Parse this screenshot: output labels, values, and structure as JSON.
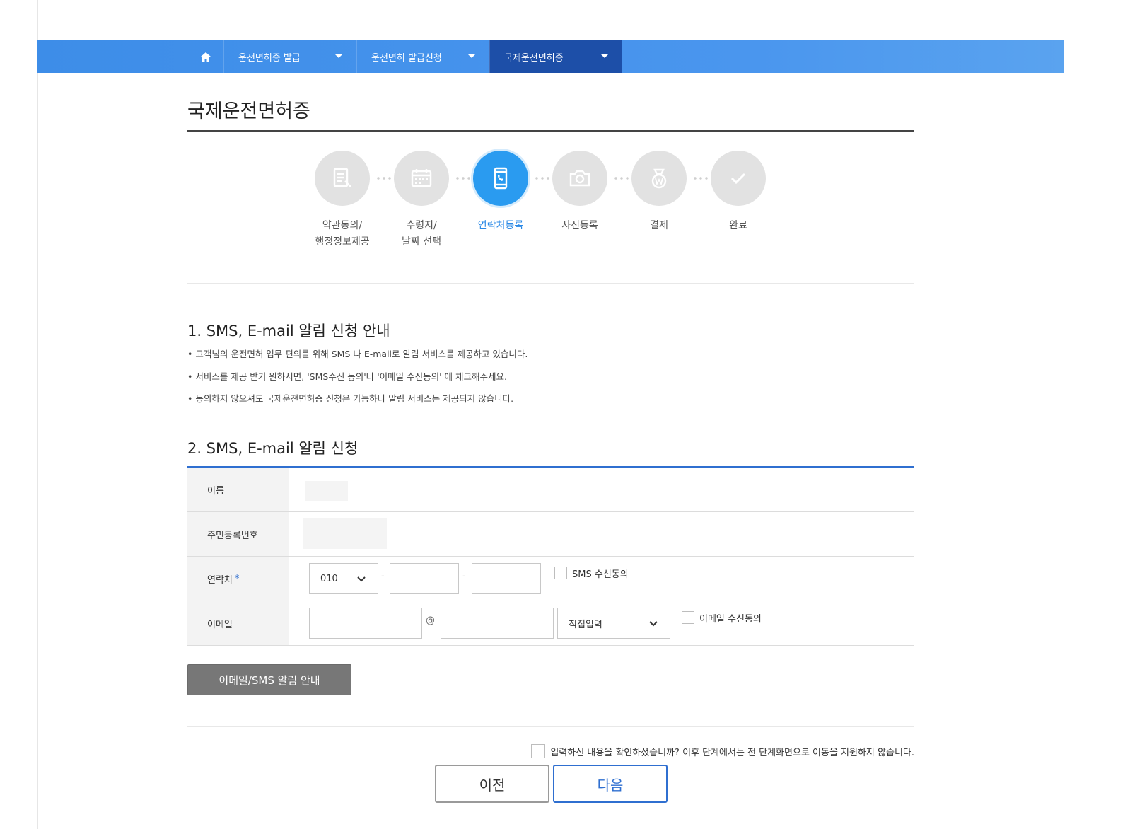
{
  "nav": {
    "items": [
      {
        "label": "운전면허증 발급"
      },
      {
        "label": "운전면허 발급신청"
      },
      {
        "label": "국제운전면허증"
      }
    ]
  },
  "page": {
    "title": "국제운전면허증"
  },
  "steps": [
    {
      "line1": "약관동의/",
      "line2": "행정정보제공",
      "icon": "document-icon"
    },
    {
      "line1": "수령지/",
      "line2": "날짜 선택",
      "icon": "calendar-icon"
    },
    {
      "line1": "연락처등록",
      "line2": "",
      "icon": "phone-icon",
      "active": true
    },
    {
      "line1": "사진등록",
      "line2": "",
      "icon": "camera-icon"
    },
    {
      "line1": "결제",
      "line2": "",
      "icon": "payment-icon"
    },
    {
      "line1": "완료",
      "line2": "",
      "icon": "check-icon"
    }
  ],
  "section1": {
    "title": "1. SMS, E-mail 알림 신청 안내",
    "notices": [
      "고객님의 운전면허 업무 편의를 위해 SMS 나 E-mail로 알림 서비스를 제공하고 있습니다.",
      "서비스를 제공 받기 원하시면, 'SMS수신 동의'나 '이메일 수신동의' 에 체크해주세요.",
      "동의하지 않으셔도 국제운전면허증 신청은 가능하나 알림 서비스는 제공되지 않습니다."
    ]
  },
  "section2": {
    "title": "2. SMS, E-mail 알림 신청",
    "name_label": "이름",
    "rrn_label": "주민등록번호",
    "phone_label": "연락처",
    "required_mark": "*",
    "phone_prefix": "010",
    "dash": "-",
    "sms_consent": "SMS 수신동의",
    "email_label": "이메일",
    "at": "@",
    "email_domain_select": "직접입력",
    "email_consent": "이메일 수신동의",
    "guide_button": "이메일/SMS 알림 안내"
  },
  "footer": {
    "confirm_text": "입력하신 내용을 확인하셨습니까? 이후 단계에서는 전 단계화면으로 이동을 지원하지 않습니다.",
    "prev_button": "이전",
    "next_button": "다음"
  },
  "colors": {
    "nav": "#3d8de8",
    "nav_active": "#1d4fa8",
    "step_active": "#2a9bf0",
    "accent": "#2f6fd0",
    "guide_button": "#777777"
  }
}
